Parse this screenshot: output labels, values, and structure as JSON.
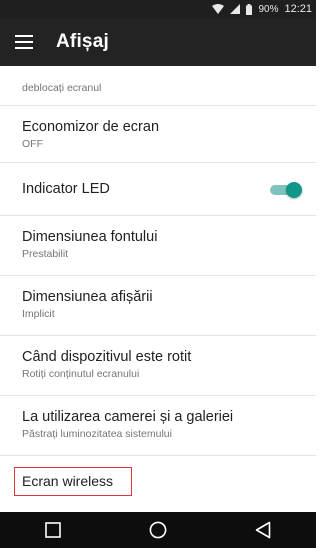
{
  "status_bar": {
    "battery": "90%",
    "time": "12:21"
  },
  "toolbar": {
    "title": "Afișaj",
    "menu_icon": "hamburger-menu-icon"
  },
  "settings": {
    "partial_item": {
      "summary": "deblocați ecranul"
    },
    "screen_saver": {
      "title": "Economizor de ecran",
      "summary": "OFF"
    },
    "led_indicator": {
      "title": "Indicator LED",
      "toggle_state": "on",
      "accent_color": "#10968a"
    },
    "font_size": {
      "title": "Dimensiunea fontului",
      "summary": "Prestabilit"
    },
    "display_size": {
      "title": "Dimensiunea afișării",
      "summary": "Implicit"
    },
    "rotation": {
      "title": "Când dispozitivul este rotit",
      "summary": "Rotiți conținutul ecranului"
    },
    "camera_gallery": {
      "title": "La utilizarea camerei și a galeriei",
      "summary": "Păstrați luminozitatea sistemului"
    },
    "wireless_display": {
      "title": "Ecran wireless",
      "highlight_color": "#e0353b"
    }
  },
  "navbar": {
    "recents_icon": "recents-square-icon",
    "home_icon": "home-circle-icon",
    "back_icon": "back-triangle-icon"
  }
}
